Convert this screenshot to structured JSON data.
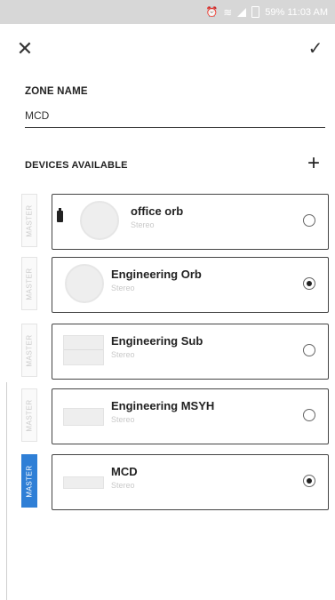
{
  "status_bar": {
    "text": "59% 11:03 AM"
  },
  "toolbar": {
    "close_icon": "close-icon",
    "confirm_icon": "check-icon"
  },
  "zone": {
    "label": "ZONE NAME",
    "value": "MCD"
  },
  "devices": {
    "header": "DEVICES AVAILABLE",
    "add_icon": "plus-icon",
    "items": [
      {
        "master_label": "MASTER",
        "name": "office orb",
        "subtitle": "Stereo",
        "selected": false,
        "master_active": false
      },
      {
        "master_label": "MASTER",
        "name": "Engineering Orb",
        "subtitle": "Stereo",
        "selected": true,
        "master_active": false
      },
      {
        "master_label": "MASTER",
        "name": "Engineering Sub",
        "subtitle": "Stereo",
        "selected": false,
        "master_active": false
      },
      {
        "master_label": "MASTER",
        "name": "Engineering MSYH",
        "subtitle": "Stereo",
        "selected": false,
        "master_active": false
      },
      {
        "master_label": "MASTER",
        "name": "MCD",
        "subtitle": "Stereo",
        "selected": true,
        "master_active": true
      }
    ]
  }
}
